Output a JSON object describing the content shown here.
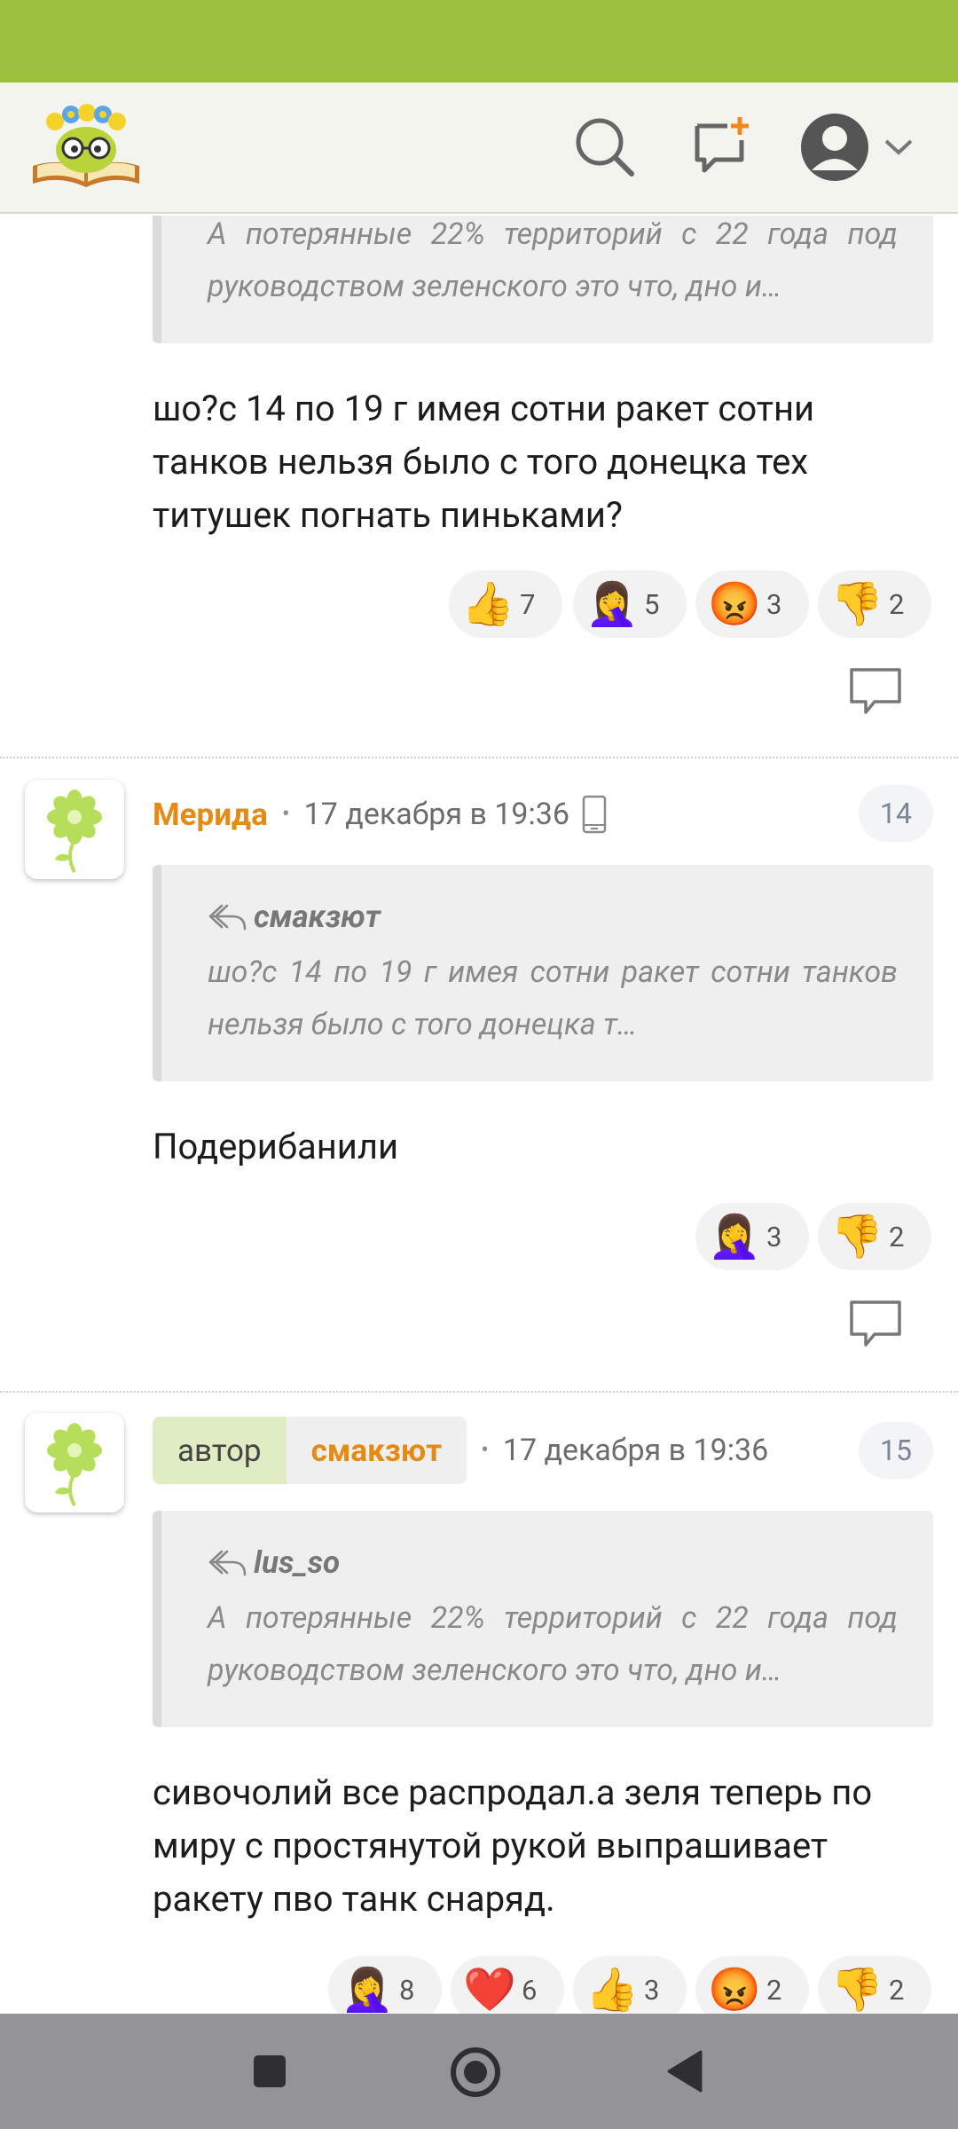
{
  "colors": {
    "status_bar": "#9dc13f",
    "accent_orange": "#e58a12",
    "author_green": "#e0ecc4"
  },
  "header": {
    "icons": [
      "logo-icon",
      "search-icon",
      "new-message-icon",
      "profile-icon",
      "chevron-down-icon"
    ]
  },
  "comments": [
    {
      "quote_text": "А потерянные 22% территорий с 22 года под руководством зеленского это что, дно и…",
      "body": "шо?с 14 по 19 г имея сотни ракет сотни танков нельзя было с того донецка тех титушек погнать пиньками?",
      "reactions": [
        {
          "emoji": "👍",
          "icon": "thumbs-up-icon",
          "count": "7"
        },
        {
          "emoji": "🤦‍♀️",
          "icon": "facepalm-icon",
          "count": "5"
        },
        {
          "emoji": "😡",
          "icon": "angry-face-icon",
          "count": "3"
        },
        {
          "emoji": "👎",
          "icon": "thumbs-down-icon",
          "count": "2"
        }
      ]
    },
    {
      "username": "Мерида",
      "date": "17 декабря в 19:36",
      "number": "14",
      "quote_author": "смакзют",
      "quote_text": "шо?с 14 по 19 г имея сотни ракет сотни танков нельзя было с того донецка т…",
      "body": "Подерибанили",
      "reactions": [
        {
          "emoji": "🤦‍♀️",
          "icon": "facepalm-icon",
          "count": "3"
        },
        {
          "emoji": "👎",
          "icon": "thumbs-down-icon",
          "count": "2"
        }
      ]
    },
    {
      "author_label": "автор",
      "username": "смакзют",
      "date": "17 декабря в 19:36",
      "number": "15",
      "quote_author": "lus_so",
      "quote_text": "А потерянные 22% территорий с 22 года под руководством зеленского это что, дно и…",
      "body": "сивочолий все распродал.а зеля теперь по миру с простянутой рукой выпрашивает ракету пво танк снаряд.",
      "reactions": [
        {
          "emoji": "🤦‍♀️",
          "icon": "facepalm-icon",
          "count": "8"
        },
        {
          "emoji": "❤️",
          "icon": "heart-icon",
          "count": "6"
        },
        {
          "emoji": "👍",
          "icon": "thumbs-up-icon",
          "count": "3"
        },
        {
          "emoji": "😡",
          "icon": "angry-face-icon",
          "count": "2"
        },
        {
          "emoji": "👎",
          "icon": "thumbs-down-icon",
          "count": "2"
        }
      ]
    }
  ]
}
